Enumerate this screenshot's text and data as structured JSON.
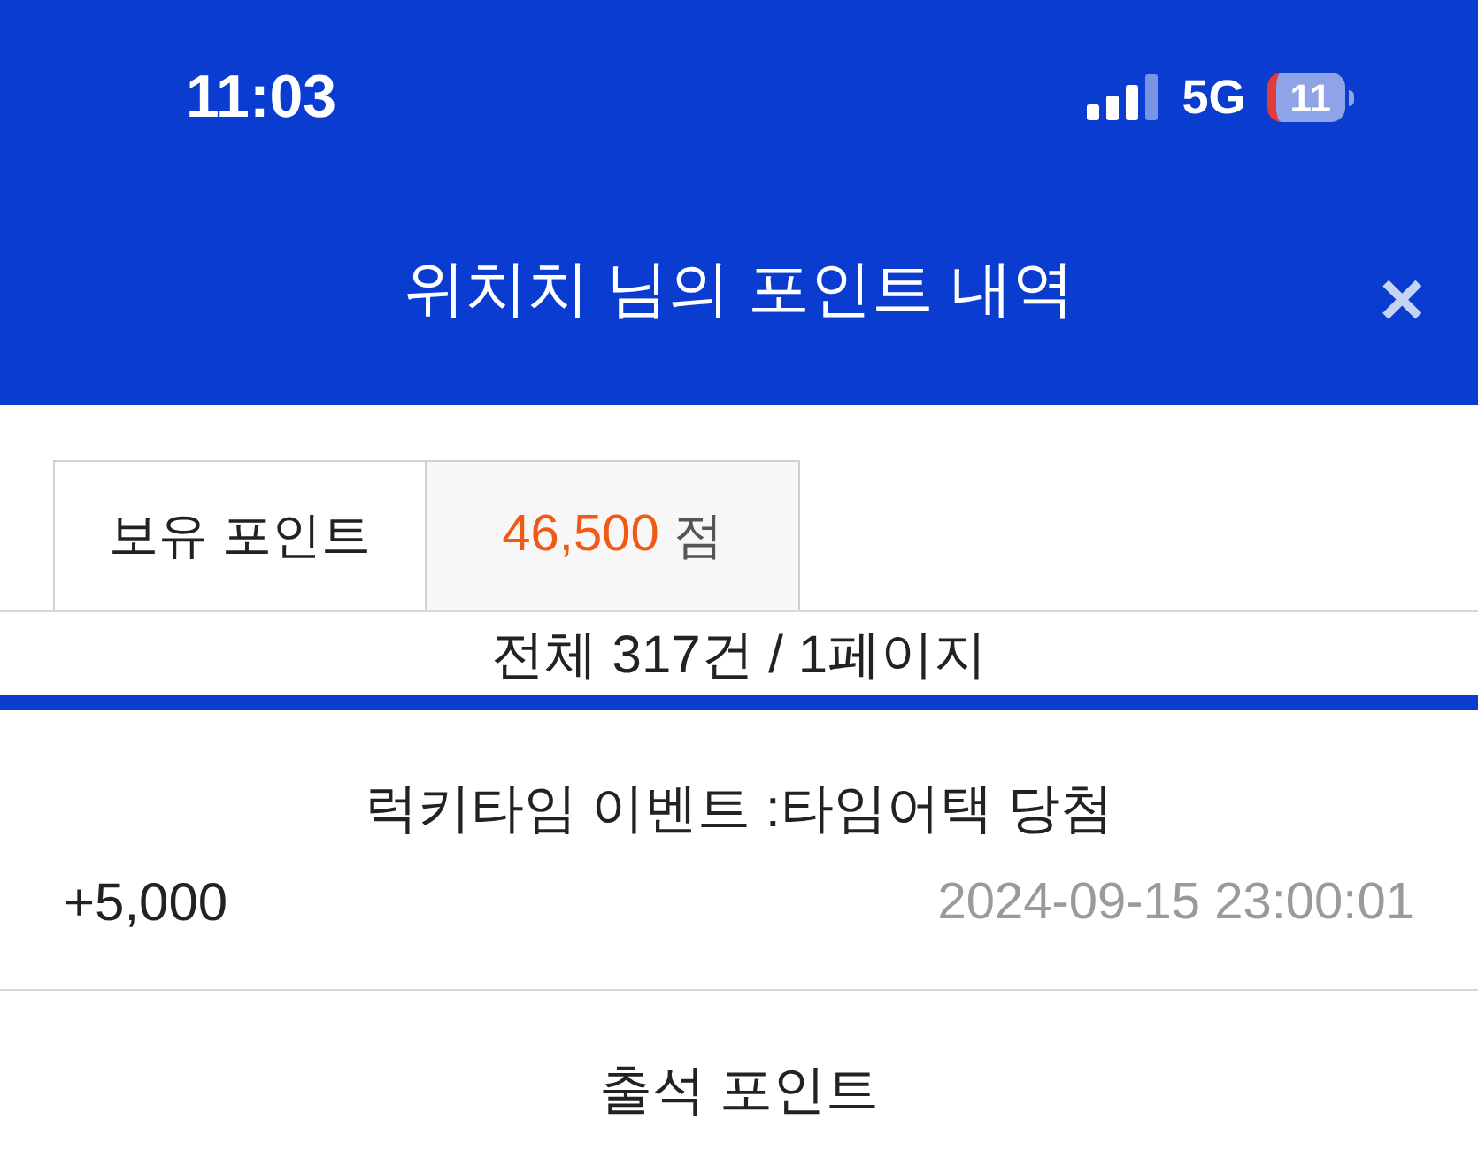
{
  "status_bar": {
    "time": "11:03",
    "network": "5G",
    "battery": "11"
  },
  "header": {
    "title": "위치치 님의 포인트 내역",
    "close": "×"
  },
  "points": {
    "label": "보유 포인트",
    "value": "46,500",
    "unit": "점"
  },
  "summary": "전체 317건 / 1페이지",
  "entries": [
    {
      "title": "럭키타임 이벤트 :타임어택 당첨",
      "amount": "+5,000",
      "date": "2024-09-15 23:00:01"
    },
    {
      "title": "출석 포인트"
    }
  ]
}
